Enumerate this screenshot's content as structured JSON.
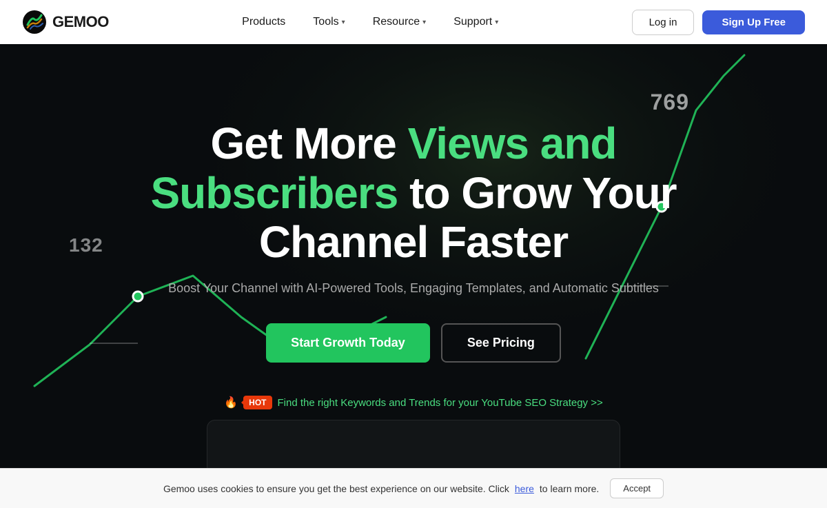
{
  "brand": {
    "name": "GEMOO",
    "logo_alt": "Gemoo Logo"
  },
  "nav": {
    "products_label": "Products",
    "tools_label": "Tools",
    "resource_label": "Resource",
    "support_label": "Support",
    "login_label": "Log in",
    "signup_label": "Sign Up Free"
  },
  "hero": {
    "title_part1": "Get More ",
    "title_accent": "Views and Subscribers",
    "title_part2": " to Grow Your Channel Faster",
    "subtitle": "Boost Your Channel with AI-Powered Tools, Engaging Templates, and Automatic Subtitles",
    "cta_primary": "Start Growth Today",
    "cta_secondary": "See Pricing",
    "hot_badge": "HOT",
    "hot_link": "Find the right Keywords and Trends for your YouTube SEO Strategy >>",
    "graph_num1": "769",
    "graph_num2": "132"
  },
  "cookie": {
    "text": "Gemoo uses cookies to ensure you get the best experience on our website. Click ",
    "link_text": "here",
    "text2": " to learn more.",
    "accept_label": "Accept"
  }
}
